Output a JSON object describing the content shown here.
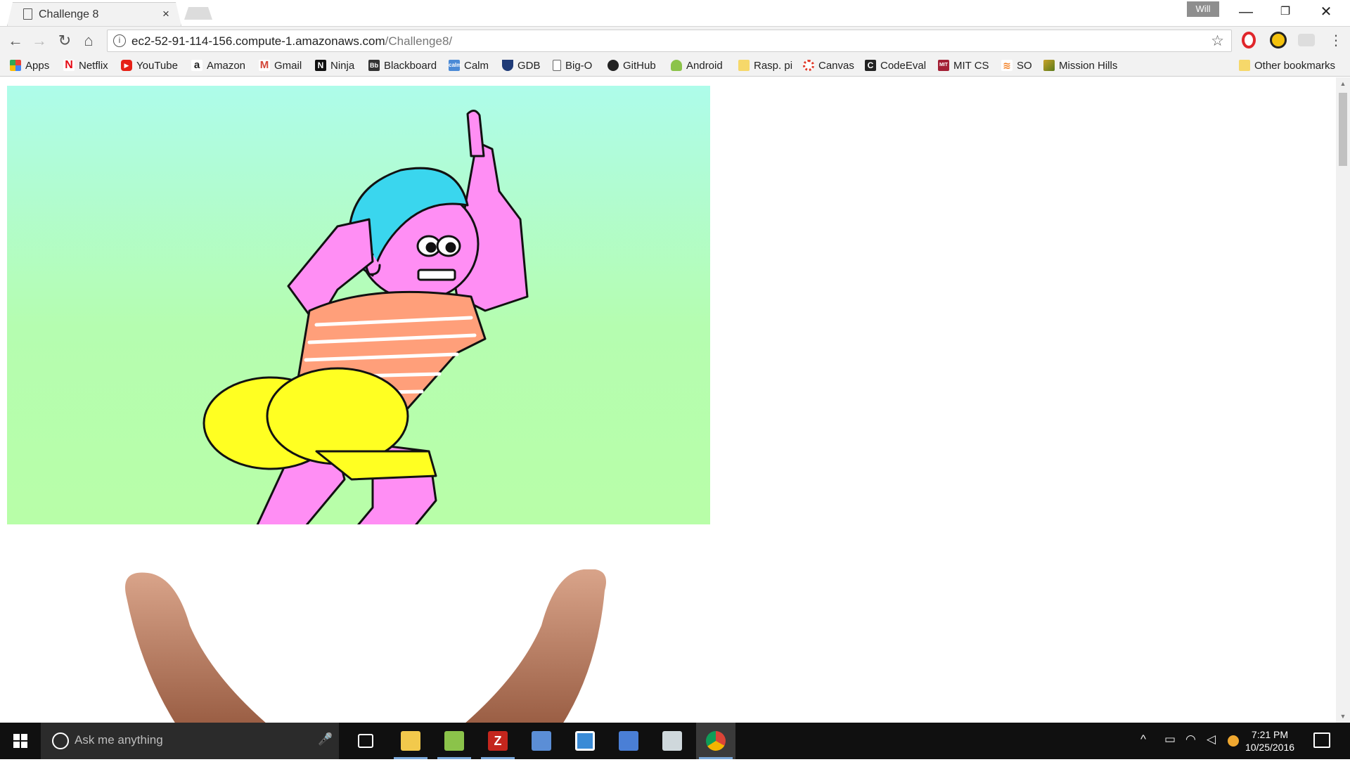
{
  "browser": {
    "tab_title": "Challenge 8",
    "tab_close": "×",
    "profile_name": "Will",
    "window_controls": {
      "minimize": "—",
      "restore": "❐",
      "close": "✕"
    }
  },
  "toolbar": {
    "back": "←",
    "forward": "→",
    "reload": "↻",
    "home": "⌂",
    "url_host": "ec2-52-91-114-156.compute-1.amazonaws.com",
    "url_path": "/Challenge8/",
    "info_icon": "i",
    "star": "☆",
    "menu": "⋮"
  },
  "bookmarks": [
    {
      "label": "Apps",
      "icon": "apps-grid-icon",
      "color": "#4a7fd6"
    },
    {
      "label": "Netflix",
      "icon": "netflix-icon",
      "color": "#e50914"
    },
    {
      "label": "YouTube",
      "icon": "youtube-icon",
      "color": "#e62117"
    },
    {
      "label": "Amazon",
      "icon": "amazon-icon",
      "color": "#222222"
    },
    {
      "label": "Gmail",
      "icon": "gmail-icon",
      "color": "#d44638"
    },
    {
      "label": "Ninja",
      "icon": "ninja-icon",
      "color": "#111111"
    },
    {
      "label": "Blackboard",
      "icon": "blackboard-icon",
      "color": "#333333"
    },
    {
      "label": "Calm",
      "icon": "calm-icon",
      "color": "#4b8ad6"
    },
    {
      "label": "GDB",
      "icon": "gdb-icon",
      "color": "#1f3b77"
    },
    {
      "label": "Big-O",
      "icon": "page-icon",
      "color": "#ffffff"
    },
    {
      "label": "GitHub",
      "icon": "github-icon",
      "color": "#222222"
    },
    {
      "label": "Android",
      "icon": "android-icon",
      "color": "#8cc34a"
    },
    {
      "label": "Rasp. pi",
      "icon": "folder-icon",
      "color": "#f6d86a"
    },
    {
      "label": "Canvas",
      "icon": "canvas-icon",
      "color": "#e03b2b"
    },
    {
      "label": "CodeEval",
      "icon": "codeeval-icon",
      "color": "#222222"
    },
    {
      "label": "MIT CS",
      "icon": "mit-icon",
      "color": "#a31f34"
    },
    {
      "label": "SO",
      "icon": "stackoverflow-icon",
      "color": "#f48024"
    },
    {
      "label": "Mission Hills",
      "icon": "mission-hills-icon",
      "color": "#5a7a1a"
    }
  ],
  "other_bookmarks": "Other bookmarks",
  "taskbar": {
    "search_placeholder": "Ask me anything",
    "apps": [
      {
        "name": "task-view",
        "color": "#ffffff"
      },
      {
        "name": "file-explorer",
        "color": "#f2c94c"
      },
      {
        "name": "notepad-plus",
        "color": "#8bc34a"
      },
      {
        "name": "filezilla",
        "color": "#c4261d"
      },
      {
        "name": "virtualbox",
        "color": "#5b8ed6"
      },
      {
        "name": "scrivener",
        "color": "#3a8bd6"
      },
      {
        "name": "network",
        "color": "#4a7fd6"
      },
      {
        "name": "scanner",
        "color": "#cfd8dc"
      },
      {
        "name": "chrome",
        "color": "#4285f4"
      }
    ],
    "time": "7:21 PM",
    "date": "10/25/2016"
  }
}
